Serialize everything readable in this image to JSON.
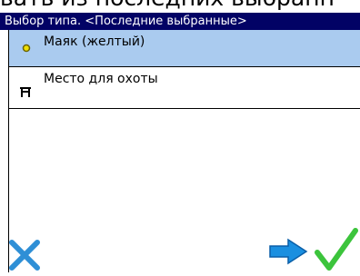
{
  "header": {
    "cut_text": "вать из последних выбранн",
    "title": "Выбор типа. <Последние выбранные>"
  },
  "list": {
    "items": [
      {
        "label": "Маяк (желтый)",
        "icon": "yellow-dot-icon",
        "selected": true
      },
      {
        "label": "Место для охоты",
        "icon": "hunting-stand-icon",
        "selected": false
      }
    ]
  },
  "buttons": {
    "cancel": {
      "icon": "close-x-icon"
    },
    "next": {
      "icon": "arrow-right-icon"
    },
    "ok": {
      "icon": "checkmark-icon"
    }
  },
  "colors": {
    "title_bg": "#020265",
    "selected_bg": "#aacbef",
    "cancel_blue": "#2e8fd6",
    "arrow_blue": "#1a8fe0",
    "check_green": "#3cc43c"
  }
}
